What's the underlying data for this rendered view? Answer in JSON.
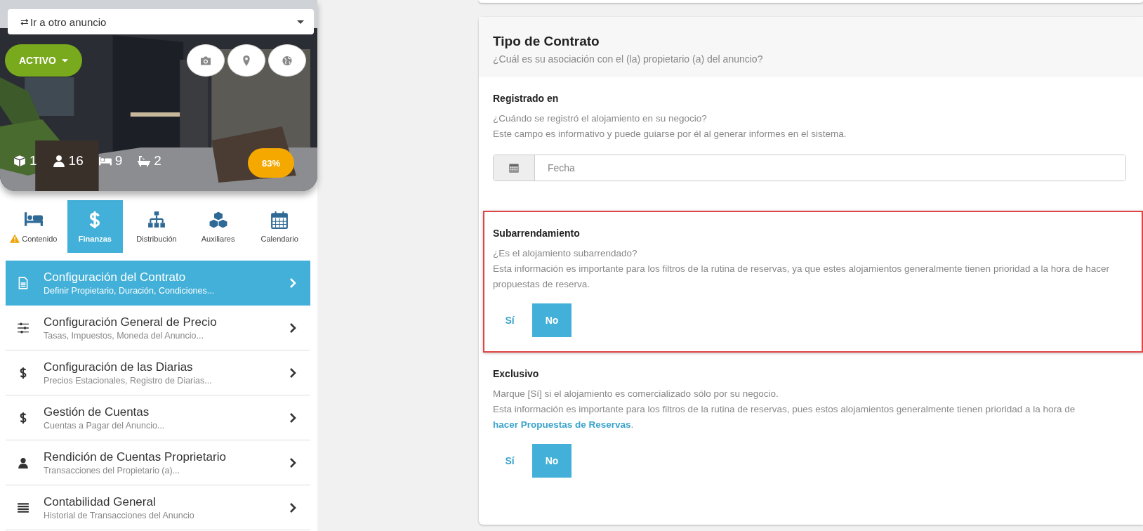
{
  "listing_selector": {
    "icon": "⇄",
    "label": "Ir a otro anuncio"
  },
  "status_button": {
    "label": "ACTIVO"
  },
  "stats": [
    {
      "kind": "units",
      "value": "1"
    },
    {
      "kind": "guests",
      "value": "16"
    },
    {
      "kind": "beds",
      "value": "9"
    },
    {
      "kind": "baths",
      "value": "2"
    }
  ],
  "completion": "83%",
  "tabs": [
    {
      "kind": "bed",
      "label": "Contenido",
      "warning": true,
      "selected": false
    },
    {
      "kind": "dollar",
      "label": "Finanzas",
      "warning": false,
      "selected": true
    },
    {
      "kind": "sitemap",
      "label": "Distribución",
      "warning": false,
      "selected": false
    },
    {
      "kind": "cubes",
      "label": "Auxiliares",
      "warning": false,
      "selected": false
    },
    {
      "kind": "calendar",
      "label": "Calendario",
      "warning": false,
      "selected": false
    }
  ],
  "menu": [
    {
      "kind": "document",
      "title": "Configuración del Contrato",
      "subtitle": "Definir Propietario, Duración, Condiciones...",
      "selected": true
    },
    {
      "kind": "sliders",
      "title": "Configuración General de Precio",
      "subtitle": "Tasas, Impuestos, Moneda del Anuncio...",
      "selected": false
    },
    {
      "kind": "dollar",
      "title": "Configuración de las Diarias",
      "subtitle": "Precios Estacionales, Registro de Diarias...",
      "selected": false
    },
    {
      "kind": "dollar",
      "title": "Gestión de Cuentas",
      "subtitle": "Cuentas a Pagar del Anuncio...",
      "selected": false
    },
    {
      "kind": "user",
      "title": "Rendición de Cuentas Proprietario",
      "subtitle": "Transacciones del Propietario (a)...",
      "selected": false
    },
    {
      "kind": "list",
      "title": "Contabilidad General",
      "subtitle": "Historial de Transacciones del Anuncio",
      "selected": false
    }
  ],
  "card": {
    "title": "Tipo de Contrato",
    "subtitle": "¿Cuál es su asociación con el (la) propietario (a) del anuncio?",
    "sections": [
      {
        "kind": "date",
        "title": "Registrado en",
        "lines": [
          "¿Cuándo se registró el alojamiento en su negocio?",
          "Este campo es informativo y puede guiarse por él al generar informes en el sistema."
        ],
        "placeholder": "Fecha",
        "highlighted": false
      },
      {
        "kind": "toggle",
        "title": "Subarrendamiento",
        "lines": [
          "¿Es el alojamiento subarrendado?",
          "Esta información es importante para los filtros de la rutina de reservas, ya que estes alojamientos generalmente tienen prioridad a la hora de hacer propuestas de reserva."
        ],
        "options": [
          {
            "label": "Sí",
            "selected": false
          },
          {
            "label": "No",
            "selected": true
          }
        ],
        "highlighted": true
      },
      {
        "kind": "toggle",
        "title": "Exclusivo",
        "lines": [
          "Marque [Sí] si el alojamiento es comercializado sólo por su negocio.",
          "Esta información es importante para los filtros de la rutina de reservas, pues estos alojamientos generalmente tienen prioridad a la hora de"
        ],
        "link": "hacer Propuestas de Reservas",
        "link_suffix": ".",
        "options": [
          {
            "label": "Sí",
            "selected": false
          },
          {
            "label": "No",
            "selected": true
          }
        ],
        "highlighted": false
      }
    ]
  }
}
